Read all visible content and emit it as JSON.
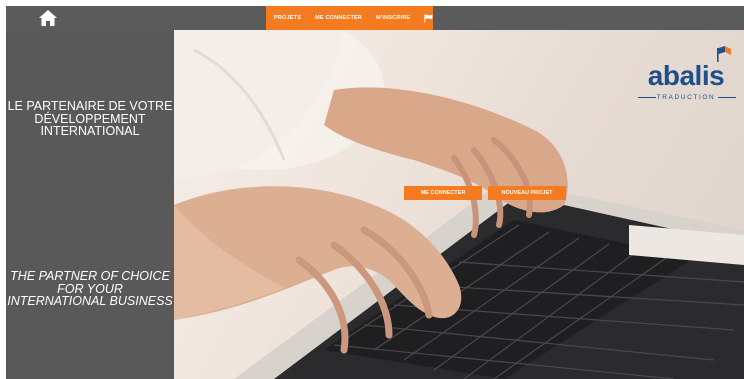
{
  "nav": {
    "items": [
      "PROJETS",
      "ME CONNECTER",
      "M'INSCRIRE"
    ],
    "flag_icon": "flag-icon",
    "home_icon": "home-icon"
  },
  "side": {
    "tagline_fr": "LE PARTENAIRE DE VOTRE DÉVELOPPEMENT INTERNATIONAL",
    "tagline_en": "THE PARTNER OF CHOICE FOR YOUR INTERNATIONAL BUSINESS"
  },
  "logo": {
    "word": "abalis",
    "sub": "TRADUCTION"
  },
  "cta": {
    "login": "ME CONNECTER",
    "new_project": "NOUVEAU PROJET"
  },
  "colors": {
    "accent": "#f47b20",
    "sidebar": "#595959",
    "topbar": "#5b5b5b",
    "logo": "#1e4f8c"
  }
}
